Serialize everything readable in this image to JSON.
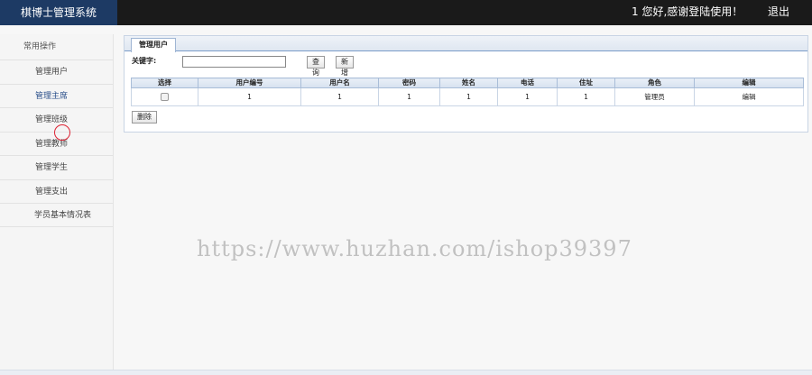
{
  "header": {
    "logo": "棋博士管理系统",
    "greeting": "1 您好,感谢登陆使用！",
    "logout": "退出"
  },
  "sidebar": {
    "title": "常用操作",
    "items": [
      {
        "label": "管理用户"
      },
      {
        "label": "管理主席"
      },
      {
        "label": "管理班级"
      },
      {
        "label": "管理教师"
      },
      {
        "label": "管理学生"
      },
      {
        "label": "管理支出"
      },
      {
        "label": "学员基本情况表"
      }
    ]
  },
  "panel": {
    "tab": "管理用户",
    "search": {
      "label": "关键字:",
      "value": "",
      "placeholder": ""
    },
    "query_button": "查询",
    "add_button": "新增",
    "delete_button": "删除",
    "table": {
      "columns": [
        "选择",
        "用户编号",
        "用户名",
        "密码",
        "姓名",
        "电话",
        "住址",
        "角色",
        "编辑"
      ],
      "rows": [
        {
          "id": "1",
          "username": "1",
          "password": "1",
          "name": "1",
          "phone": "1",
          "address": "1",
          "role": "管理员",
          "edit": "编辑"
        }
      ]
    }
  },
  "watermark": "https://www.huzhan.com/ishop39397"
}
